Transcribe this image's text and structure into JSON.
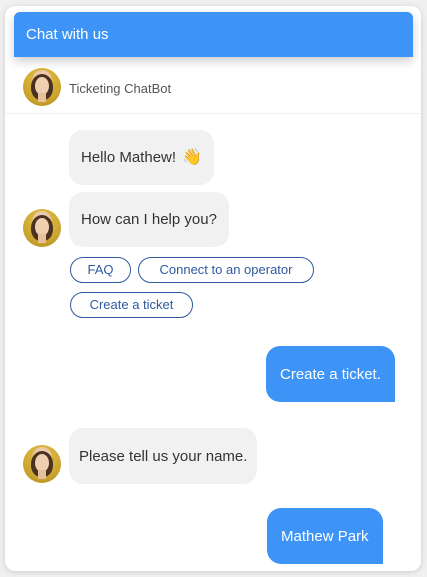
{
  "header": {
    "title": "Chat with us"
  },
  "agent": {
    "name": "Ticketing ChatBot"
  },
  "messages": [
    {
      "from": "bot",
      "text": "Hello Mathew!",
      "emoji": "👋"
    },
    {
      "from": "bot",
      "text": "How can I help you?"
    },
    {
      "from": "user",
      "text": "Create a ticket."
    },
    {
      "from": "bot",
      "text": "Please tell us your name."
    },
    {
      "from": "user",
      "text": "Mathew Park"
    }
  ],
  "quick_replies": [
    {
      "label": "FAQ"
    },
    {
      "label": "Connect to an operator"
    },
    {
      "label": "Create a ticket"
    }
  ],
  "colors": {
    "primary": "#3d94f6",
    "bot_bubble": "#f1f1f1",
    "chip_border": "#2f5aa0"
  },
  "icons": {
    "avatar": "agent-avatar",
    "wave": "waving-hand-emoji"
  }
}
